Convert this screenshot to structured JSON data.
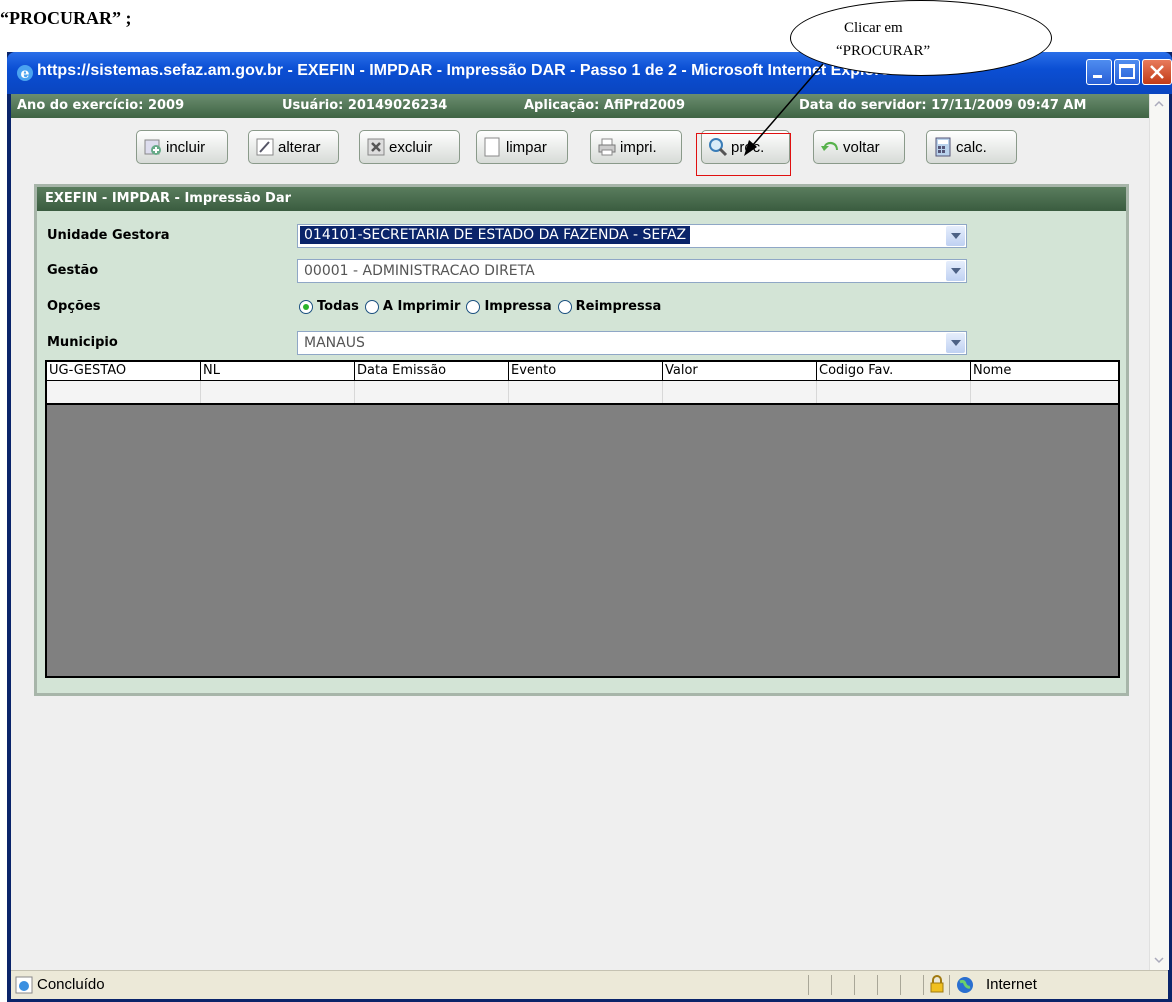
{
  "document": {
    "caption": "“PROCURAR” ;",
    "callout_line1": "Clicar em",
    "callout_line2": "“PROCURAR”"
  },
  "window": {
    "title": "https://sistemas.sefaz.am.gov.br - EXEFIN - IMPDAR - Impressão DAR - Passo 1 de 2 - Microsoft Internet Explorer",
    "icon": "ie-icon",
    "controls": [
      "minimize",
      "maximize",
      "close"
    ]
  },
  "infobar": {
    "ano": "Ano do exercício: 2009",
    "usuario": "Usuário: 20149026234",
    "aplicacao": "Aplicação: AfiPrd2009",
    "data_servidor": "Data do servidor: 17/11/2009 09:47 AM"
  },
  "toolbar": {
    "incluir": "incluir",
    "alterar": "alterar",
    "excluir": "excluir",
    "limpar": "limpar",
    "imprimir": "impri.",
    "procurar": "proc.",
    "voltar": "voltar",
    "calc": "calc."
  },
  "panel": {
    "title": "EXEFIN - IMPDAR - Impressão Dar",
    "unidade_gestora_label": "Unidade Gestora",
    "unidade_gestora_value": "014101-SECRETARIA DE ESTADO DA FAZENDA - SEFAZ",
    "gestao_label": "Gestão",
    "gestao_value": "00001 - ADMINISTRACAO DIRETA",
    "opcoes_label": "Opções",
    "opcoes": [
      "Todas",
      "A Imprimir",
      "Impressa",
      "Reimpressa"
    ],
    "opcoes_selected": "Todas",
    "municipio_label": "Municipio",
    "municipio_value": "MANAUS"
  },
  "grid": {
    "columns": [
      "UG-GESTAO",
      "NL",
      "Data Emissão",
      "Evento",
      "Valor",
      "Codigo Fav.",
      "Nome"
    ]
  },
  "statusbar": {
    "status": "Concluído",
    "zone": "Internet"
  },
  "colors": {
    "title_bar": "#0b4fd4",
    "panel_header": "#3a5c3f",
    "panel_background": "#d3e4d6",
    "highlight_border": "#e01010"
  }
}
